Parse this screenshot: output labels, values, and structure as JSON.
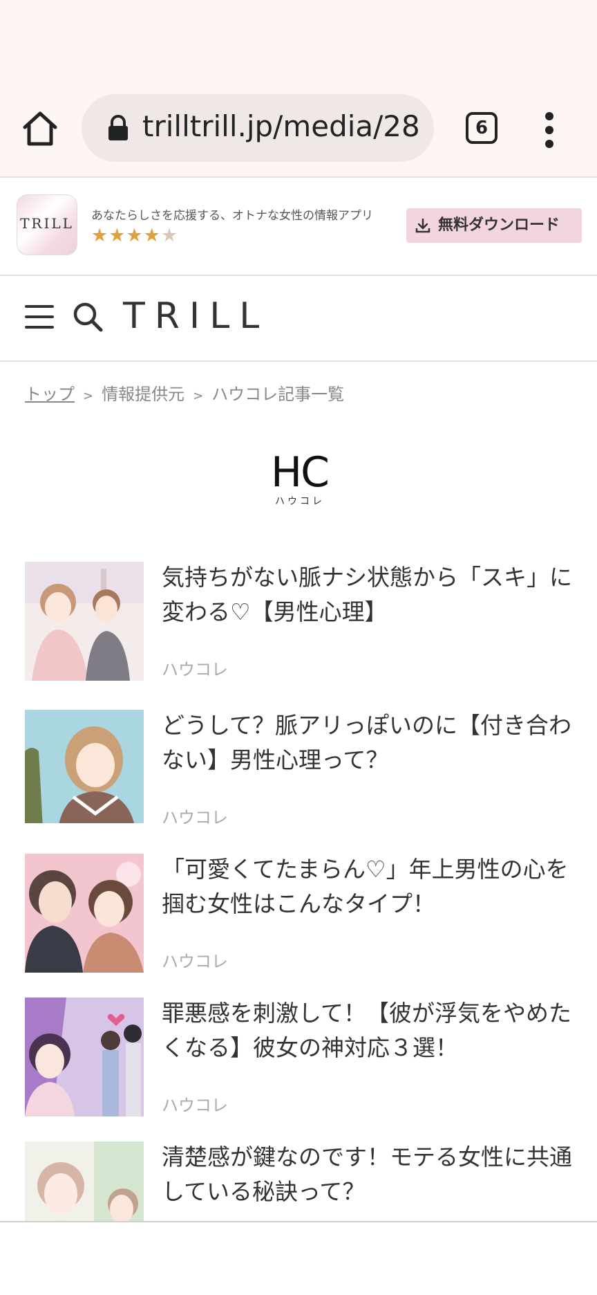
{
  "browser": {
    "url": "trilltrill.jp/media/28",
    "tab_count": "6"
  },
  "app_banner": {
    "icon_label": "TRILL",
    "tagline": "あなたらしさを応援する、オトナな女性の情報アプリ",
    "rating_stars": 4.5,
    "stars_full": "★★★★",
    "stars_half": "★",
    "download_label": "無料ダウンロード"
  },
  "header": {
    "logo": "TRILL"
  },
  "breadcrumb": {
    "home": "トップ",
    "sep": ">",
    "level2": "情報提供元",
    "level3": "ハウコレ記事一覧"
  },
  "publisher": {
    "logo_main": "HC",
    "logo_sub": "ハウコレ"
  },
  "articles": [
    {
      "title": "気持ちがない脈ナシ状態から「スキ」に変わる♡【男性心理】",
      "source": "ハウコレ"
    },
    {
      "title": "どうして？脈アリっぽいのに【付き合わない】男性心理って？",
      "source": "ハウコレ"
    },
    {
      "title": "「可愛くてたまらん♡」年上男性の心を掴む女性はこんなタイプ！",
      "source": "ハウコレ"
    },
    {
      "title": "罪悪感を刺激して！【彼が浮気をやめたくなる】彼女の神対応３選！",
      "source": "ハウコレ"
    },
    {
      "title": "清楚感が鍵なのです！モテる女性に共通している秘訣って？",
      "source": ""
    }
  ],
  "colors": {
    "chrome_bg": "#fdf6f4",
    "download_bg": "#f2d5de",
    "star": "#e2a03a"
  }
}
